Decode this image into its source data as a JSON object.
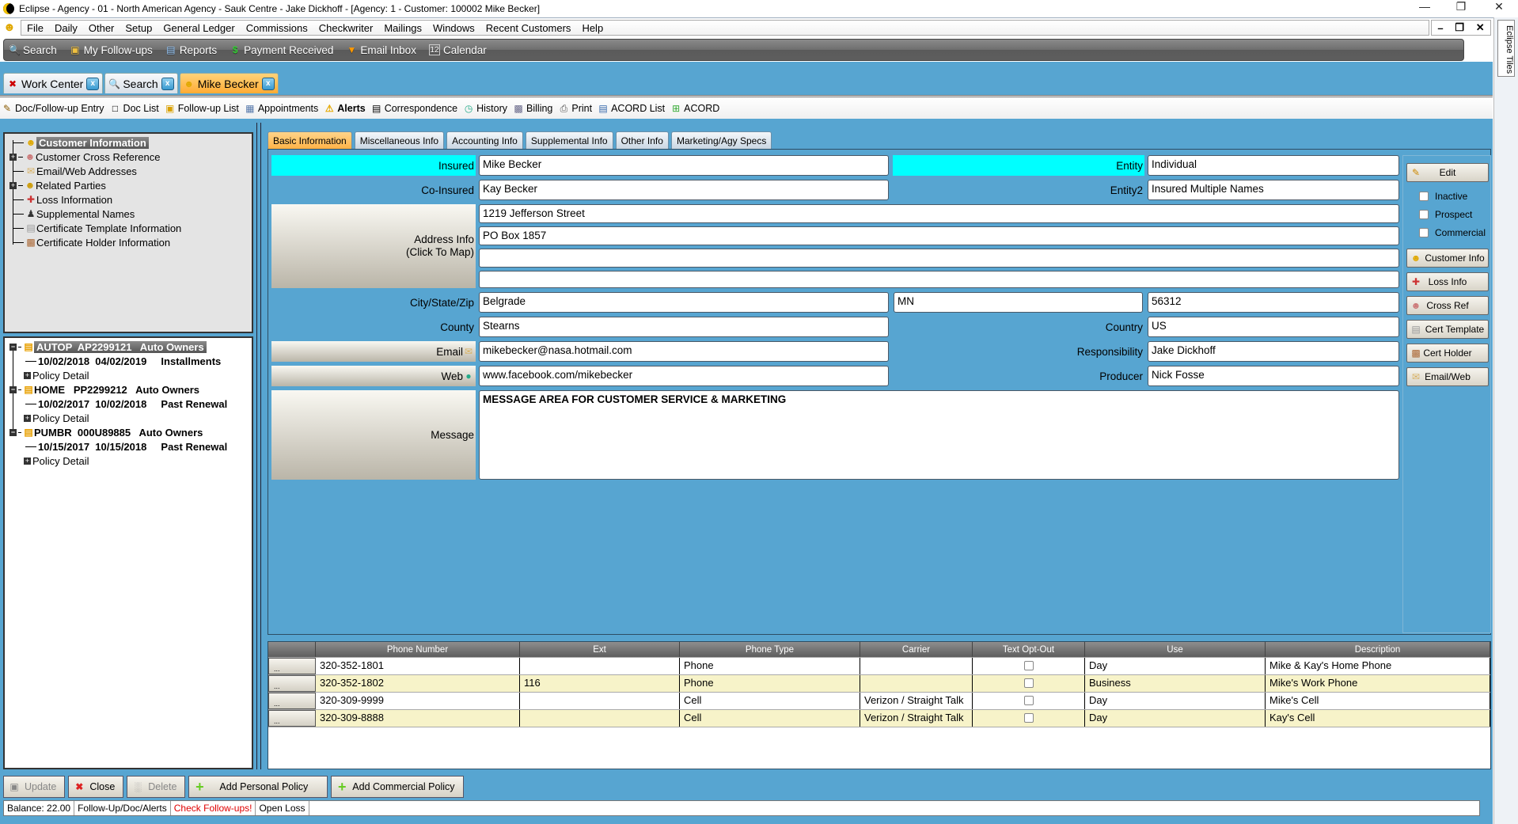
{
  "window": {
    "title": "Eclipse - Agency - 01 - North American Agency - Sauk Centre - Jake Dickhoff - [Agency: 1 - Customer: 100002 Mike Becker]",
    "controls": [
      "minimize",
      "restore",
      "close"
    ]
  },
  "menu": {
    "items": [
      "File",
      "Daily",
      "Other",
      "Setup",
      "General Ledger",
      "Commissions",
      "Checkwriter",
      "Mailings",
      "Windows",
      "Recent Customers",
      "Help"
    ]
  },
  "toolbar1": [
    {
      "label": "Search",
      "icon": "magnifier-icon"
    },
    {
      "label": "My Follow-ups",
      "icon": "notepad-icon"
    },
    {
      "label": "Reports",
      "icon": "report-icon"
    },
    {
      "label": "Payment Received",
      "icon": "dollar-icon"
    },
    {
      "label": "Email Inbox",
      "icon": "inbox-icon"
    },
    {
      "label": "Calendar",
      "icon": "calendar-icon"
    }
  ],
  "side_tiles": {
    "label": "Eclipse Tiles"
  },
  "doc_tabs": [
    {
      "label": "Work Center",
      "icon": "tools-icon"
    },
    {
      "label": "Search",
      "icon": "magnifier-icon"
    },
    {
      "label": "Mike Becker",
      "icon": "user-icon",
      "active": true
    }
  ],
  "toolbar2": [
    {
      "label": "Doc/Follow-up Entry",
      "icon": "pencil-icon"
    },
    {
      "label": "Doc List",
      "icon": "document-icon"
    },
    {
      "label": "Follow-up List",
      "icon": "notepad-icon"
    },
    {
      "label": "Appointments",
      "icon": "calendar-icon"
    },
    {
      "label": "Alerts",
      "icon": "warning-icon",
      "bold": true
    },
    {
      "label": "Correspondence",
      "icon": "letter-icon"
    },
    {
      "label": "History",
      "icon": "clock-icon"
    },
    {
      "label": "Billing",
      "icon": "register-icon"
    },
    {
      "label": "Print",
      "icon": "printer-icon"
    },
    {
      "label": "ACORD List",
      "icon": "form-icon"
    },
    {
      "label": "ACORD",
      "icon": "form-add-icon"
    }
  ],
  "customer_tree": [
    {
      "label": "Customer Information",
      "selected": true,
      "expand": false
    },
    {
      "label": "Customer Cross Reference",
      "expand": true
    },
    {
      "label": "Email/Web Addresses",
      "expand": false
    },
    {
      "label": "Related Parties",
      "expand": true
    },
    {
      "label": "Loss Information",
      "expand": false
    },
    {
      "label": "Supplemental Names",
      "expand": false
    },
    {
      "label": "Certificate Template Information",
      "expand": false
    },
    {
      "label": "Certificate Holder Information",
      "expand": false
    }
  ],
  "policy_tree": [
    {
      "header": "AUTOP  AP2299121   Auto Owners",
      "dates": "10/02/2018  04/02/2019     Installments",
      "detail": "Policy Detail",
      "selected": true
    },
    {
      "header": "HOME   PP2299212   Auto Owners",
      "dates": "10/02/2017  10/02/2018     Past Renewal",
      "detail": "Policy Detail"
    },
    {
      "header": "PUMBR  000U89885   Auto Owners",
      "dates": "10/15/2017  10/15/2018     Past Renewal",
      "detail": "Policy Detail"
    }
  ],
  "form_tabs": [
    "Basic Information",
    "Miscellaneous Info",
    "Accounting Info",
    "Supplemental Info",
    "Other Info",
    "Marketing/Agy Specs"
  ],
  "form": {
    "insured_label": "Insured",
    "insured": "Mike Becker",
    "coinsured_label": "Co-Insured",
    "coinsured": "Kay Becker",
    "entity_label": "Entity",
    "entity": "Individual",
    "entity2_label": "Entity2",
    "entity2": "Insured Multiple Names",
    "address_label": "Address Info\n(Click To Map)",
    "address": [
      "1219 Jefferson Street",
      "PO Box 1857",
      "",
      ""
    ],
    "csz_label": "City/State/Zip",
    "city": "Belgrade",
    "state": "MN",
    "zip": "56312",
    "county_label": "County",
    "county": "Stearns",
    "country_label": "Country",
    "country": "US",
    "email_label": "Email",
    "email": "mikebecker@nasa.hotmail.com",
    "responsibility_label": "Responsibility",
    "responsibility": "Jake Dickhoff",
    "web_label": "Web",
    "web": "www.facebook.com/mikebecker",
    "producer_label": "Producer",
    "producer": "Nick Fosse",
    "message_label": "Message",
    "message": "MESSAGE AREA FOR CUSTOMER SERVICE & MARKETING"
  },
  "side_buttons": {
    "edit": "Edit",
    "checks": [
      {
        "label": "Inactive",
        "checked": false
      },
      {
        "label": "Prospect",
        "checked": false
      },
      {
        "label": "Commercial",
        "checked": false
      }
    ],
    "buttons": [
      "Customer Info",
      "Loss Info",
      "Cross Ref",
      "Cert Template",
      "Cert Holder",
      "Email/Web"
    ]
  },
  "phones": {
    "columns": [
      "",
      "Phone Number",
      "Ext",
      "Phone Type",
      "Carrier",
      "Text Opt-Out",
      "Use",
      "Description"
    ],
    "rows": [
      {
        "btn": "...",
        "number": "320-352-1801",
        "ext": "",
        "type": "Phone",
        "carrier": "",
        "optout": false,
        "use": "Day",
        "desc": "Mike & Kay's Home Phone"
      },
      {
        "btn": "...",
        "number": "320-352-1802",
        "ext": "116",
        "type": "Phone",
        "carrier": "",
        "optout": false,
        "use": "Business",
        "desc": "Mike's Work Phone"
      },
      {
        "btn": "...",
        "number": "320-309-9999",
        "ext": "",
        "type": "Cell",
        "carrier": "Verizon / Straight Talk",
        "optout": false,
        "use": "Day",
        "desc": "Mike's Cell"
      },
      {
        "btn": "...",
        "number": "320-309-8888",
        "ext": "",
        "type": "Cell",
        "carrier": "Verizon / Straight Talk",
        "optout": false,
        "use": "Day",
        "desc": "Kay's Cell"
      }
    ]
  },
  "bottom_buttons": [
    {
      "label": "Update",
      "icon": "save-icon",
      "disabled": true
    },
    {
      "label": "Close",
      "icon": "close-x-icon"
    },
    {
      "label": "Delete",
      "icon": "trash-icon",
      "disabled": true
    },
    {
      "label": "Add Personal Policy",
      "icon": "plus-icon"
    },
    {
      "label": "Add Commercial Policy",
      "icon": "plus-icon"
    }
  ],
  "status": [
    "Balance: 22.00",
    "Follow-Up/Doc/Alerts",
    "Check Follow-ups!",
    "Open Loss"
  ],
  "colors": {
    "accent_blue": "#57a5d1",
    "highlight_cyan": "#00ffff",
    "active_tab": "#ffb347",
    "alert_red": "#e00000",
    "row_alt": "#f7f3c9"
  }
}
